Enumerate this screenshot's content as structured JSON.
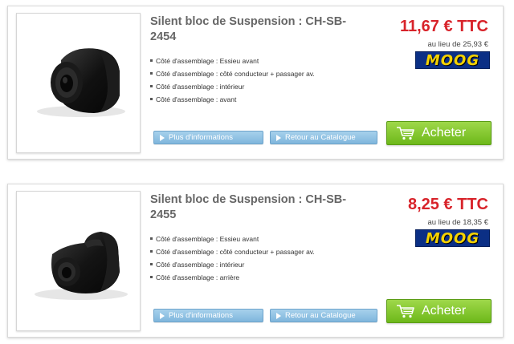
{
  "products": [
    {
      "title": "Silent bloc de Suspension : CH-SB-2454",
      "price": "11,67 € TTC",
      "old_price": "au lieu de 25,93 €",
      "brand": "MOOG",
      "features": [
        "Côté d'assemblage : Essieu avant",
        "Côté d'assemblage : côté conducteur + passager av.",
        "Côté d'assemblage : intérieur",
        "Côté d'assemblage : avant"
      ],
      "info_label": "Plus d'informations",
      "catalog_label": "Retour au Catalogue",
      "buy_label": "Acheter"
    },
    {
      "title": "Silent bloc de Suspension : CH-SB-2455",
      "price": "8,25 € TTC",
      "old_price": "au lieu de 18,35 €",
      "brand": "MOOG",
      "features": [
        "Côté d'assemblage : Essieu avant",
        "Côté d'assemblage : côté conducteur + passager av.",
        "Côté d'assemblage : intérieur",
        "Côté d'assemblage : arrière"
      ],
      "info_label": "Plus d'informations",
      "catalog_label": "Retour au Catalogue",
      "buy_label": "Acheter"
    }
  ],
  "colors": {
    "price": "#d8232a",
    "buy_button": "#7cc22a",
    "nav_button": "#8cc0e3",
    "brand_bg": "#0b2f85",
    "brand_text": "#f4d200"
  },
  "icons": {
    "button_arrow": "play-arrow-icon",
    "buy": "shopping-cart-icon"
  }
}
